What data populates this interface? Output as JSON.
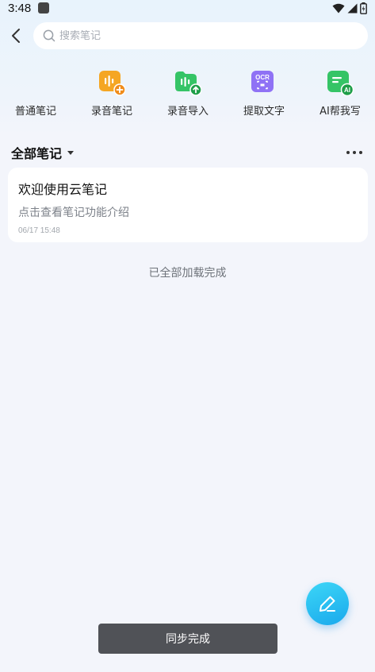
{
  "status_bar": {
    "time": "3:48"
  },
  "header": {
    "search_placeholder": "搜索笔记"
  },
  "quick_actions": [
    {
      "label": "普通笔记",
      "icon": "plain-note-icon"
    },
    {
      "label": "录音笔记",
      "icon": "voice-note-icon",
      "color": "#f5a623"
    },
    {
      "label": "录音导入",
      "icon": "voice-import-icon",
      "color": "#2fbf5b"
    },
    {
      "label": "提取文字",
      "icon": "ocr-icon",
      "icon_text": "OCR",
      "color": "#8a6cf2"
    },
    {
      "label": "AI帮我写",
      "icon": "ai-write-icon",
      "icon_text": "AI",
      "color": "#2fbf5b"
    }
  ],
  "section": {
    "title": "全部笔记"
  },
  "notes": [
    {
      "title": "欢迎使用云笔记",
      "description": "点击查看笔记功能介绍",
      "time": "06/17 15:48"
    }
  ],
  "list_footer": "已全部加载完成",
  "toast": "同步完成",
  "colors": {
    "accent": "#1aa9ec",
    "background": "#f3f5fb",
    "toast_bg": "#505257"
  }
}
